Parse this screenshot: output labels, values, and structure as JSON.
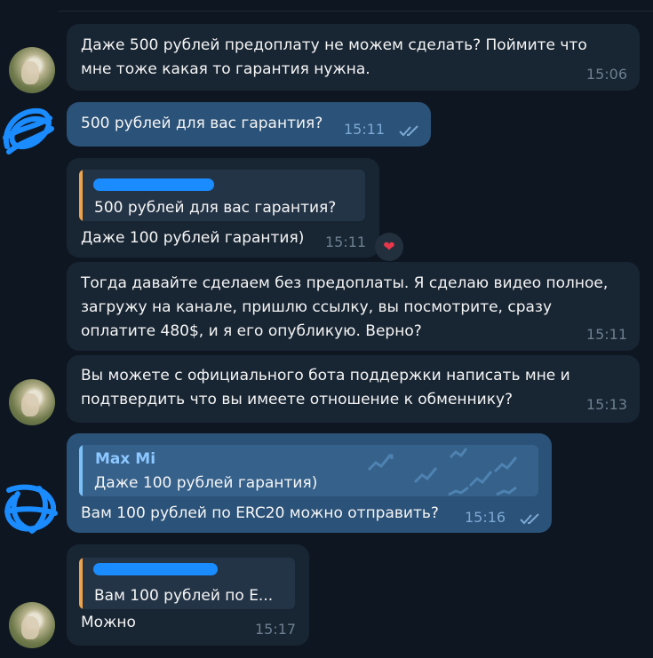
{
  "messages": [
    {
      "text": "Даже 500 рублей предоплату не можем сделать? Поймите что\nмне тоже какая то гарантия нужна.",
      "time": "15:06"
    },
    {
      "text": "500 рублей для вас гарантия?",
      "time": "15:11"
    },
    {
      "quote": "500 рублей для вас гарантия?",
      "text": "Даже 100 рублей гарантия)",
      "time": "15:11",
      "reaction": "❤"
    },
    {
      "text": "Тогда давайте сделаем без предоплаты. Я сделаю видео полное,\nзагружу на канале, пришлю ссылку, вы посмотрите, сразу\nоплатите 480$, и я его опубликую. Верно?",
      "time": "15:11"
    },
    {
      "text": "Вы можете с официального бота поддержки написать мне и\nподтвердить что вы имеете отношение к обменнику?",
      "time": "15:13"
    },
    {
      "quote_name": "Max Mi",
      "quote": "Даже 100 рублей гарантия)",
      "text": "Вам 100 рублей по ERC20 можно отправить?",
      "time": "15:16"
    },
    {
      "quote": "Вам 100 рублей по E...",
      "text": "Можно",
      "time": "15:17"
    }
  ],
  "colors": {
    "background": "#0e1621",
    "incoming_bubble": "#182533",
    "outgoing_bubble": "#2b5278",
    "redaction": "#1a8cff",
    "quote_bar_in": "#f0a24a",
    "quote_bar_out": "#7bc1f7"
  },
  "icons": {
    "read_receipt": "double-check-icon",
    "reaction": "heart-icon"
  }
}
